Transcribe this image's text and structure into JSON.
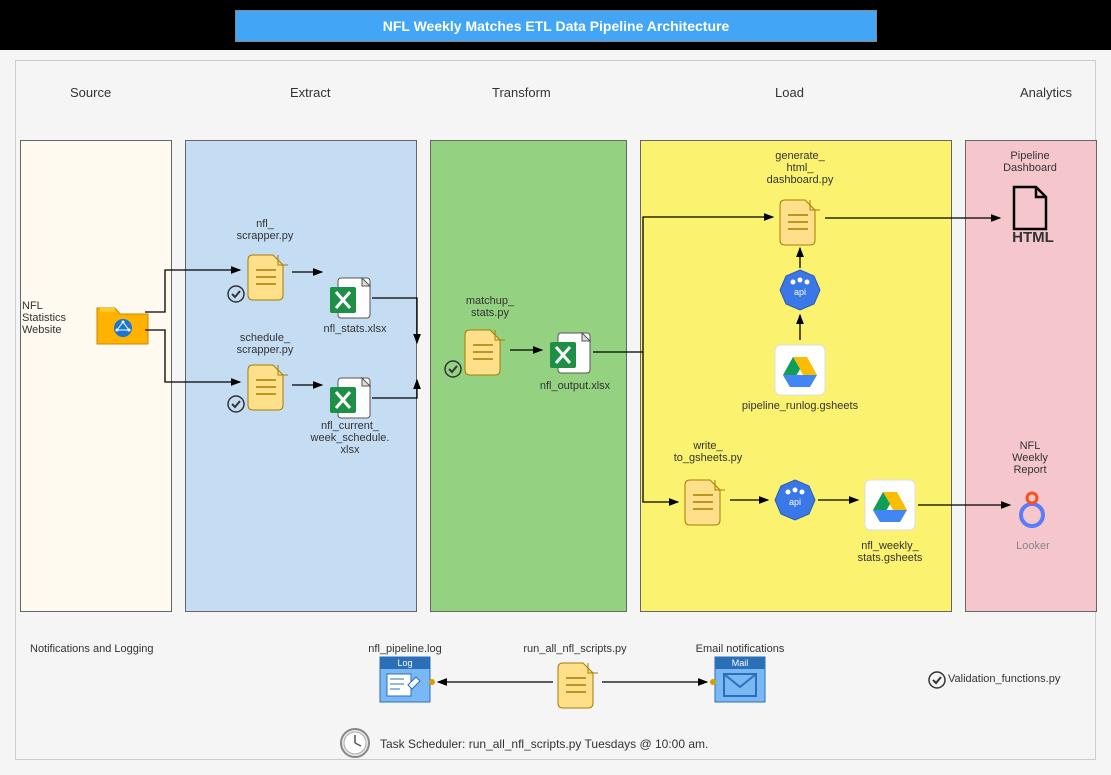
{
  "title": "NFL Weekly Matches ETL Data Pipeline Architecture",
  "stages": {
    "source": "Source",
    "extract": "Extract",
    "transform": "Transform",
    "load": "Load",
    "analytics": "Analytics"
  },
  "source": {
    "website": "NFL\nStatistics\nWebsite"
  },
  "extract": {
    "scrapper": "nfl_\nscrapper.py",
    "schedule": "schedule_\nscrapper.py",
    "stats_xlsx": "nfl_stats.xlsx",
    "week_xlsx": "nfl_current_\nweek_schedule.\nxlsx"
  },
  "transform": {
    "matchup": "matchup_\nstats.py",
    "output": "nfl_output.xlsx"
  },
  "load": {
    "dashboard_py": "generate_\nhtml_\ndashboard.py",
    "runlog": "pipeline_runlog.gsheets",
    "write_gs": "write_\nto_gsheets.py",
    "stats_gs": "nfl_weekly_\nstats.gsheets"
  },
  "analytics": {
    "dash": "Pipeline\nDashboard",
    "html": "HTML",
    "report": "NFL\nWeekly\nReport",
    "looker": "Looker"
  },
  "bottom": {
    "notif": "Notifications and Logging",
    "log_file": "nfl_pipeline.log",
    "log_badge": "Log",
    "runall": "run_all_nfl_scripts.py",
    "email": "Email notifications",
    "mail_badge": "Mail",
    "validation": "Validation_functions.py"
  },
  "scheduler": "Task Scheduler: run_all_nfl_scripts.py Tuesdays @ 10:00 am.",
  "api_label": "api"
}
